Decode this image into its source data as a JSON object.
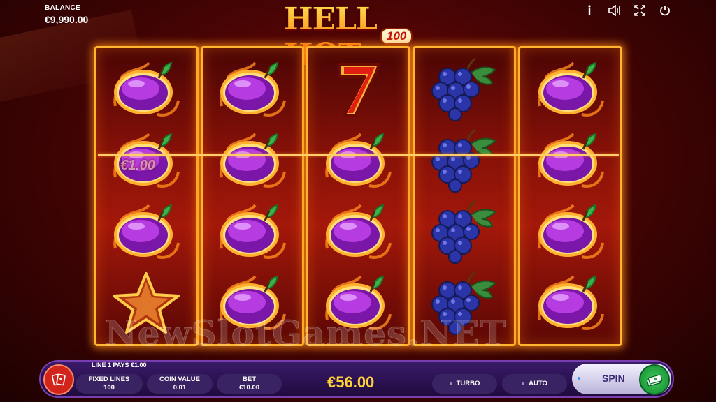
{
  "balance": {
    "label": "BALANCE",
    "value": "€9,990.00"
  },
  "logo": {
    "main": "HELL HOT",
    "sub": "100"
  },
  "top_icons": [
    "info-icon",
    "sound-icon",
    "fullscreen-icon",
    "power-icon"
  ],
  "reels": [
    [
      "plum",
      "plum",
      "plum",
      "star"
    ],
    [
      "plum",
      "plum",
      "plum",
      "plum"
    ],
    [
      "seven",
      "plum",
      "plum",
      "plum"
    ],
    [
      "grapes",
      "grapes",
      "grapes",
      "grapes"
    ],
    [
      "plum",
      "plum",
      "plum",
      "plum"
    ]
  ],
  "win_amount": "€1.00",
  "watermark": "NewSlotGames.NET",
  "line_pays": "LINE 1 PAYS €1.00",
  "controls": {
    "fixed_lines": {
      "label": "FIXED LINES",
      "value": "100"
    },
    "coin_value": {
      "label": "COIN VALUE",
      "value": "0.01"
    },
    "bet": {
      "label": "BET",
      "value": "€10.00"
    },
    "total": "€56.00",
    "turbo": "TURBO",
    "auto": "AUTO",
    "spin": "SPIN"
  },
  "colors": {
    "reel_frame": "#ffb52e",
    "total": "#ffd23a",
    "spin_button": "#2ea84a"
  }
}
